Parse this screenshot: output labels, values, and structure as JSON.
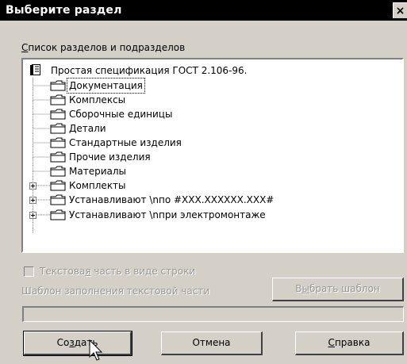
{
  "window": {
    "title": "Выберите раздел",
    "close_glyph": "×"
  },
  "section_list": {
    "label_prefix": "",
    "label_mnemonic": "С",
    "label_rest": "писок разделов и подразделов",
    "root": {
      "label": "Простая спецификация ГОСТ 2.106-96.",
      "icon": "document-book-icon"
    },
    "items": [
      {
        "label": "Документация",
        "icon": "folder-icon",
        "selected": true,
        "expandable": false
      },
      {
        "label": "Комплексы",
        "icon": "folder-icon",
        "expandable": false
      },
      {
        "label": "Сборочные единицы",
        "icon": "folder-icon",
        "expandable": false
      },
      {
        "label": "Детали",
        "icon": "folder-icon",
        "expandable": false
      },
      {
        "label": "Стандартные изделия",
        "icon": "folder-icon",
        "expandable": false
      },
      {
        "label": "Прочие изделия",
        "icon": "folder-icon",
        "expandable": false
      },
      {
        "label": "Материалы",
        "icon": "folder-icon",
        "expandable": false
      },
      {
        "label": "Комплекты",
        "icon": "folder-icon",
        "expandable": true
      },
      {
        "label": "Устанавливают \\nпо #XXX.XXXXXX.XXX#",
        "icon": "folder-icon",
        "expandable": true
      },
      {
        "label": "Устанавливают \\nпри электромонтаже",
        "icon": "folder-icon",
        "expandable": true
      }
    ]
  },
  "text_line_checkbox": {
    "prefix": "Текстова",
    "mnemonic": "я",
    "rest": " часть в виде строки",
    "checked": false,
    "enabled": false
  },
  "template": {
    "label": "Шаблон заполнения текстовой части",
    "value": "",
    "choose_prefix": "В",
    "choose_mnemonic": "ы",
    "choose_rest": "брать шаблон"
  },
  "buttons": {
    "create_prefix": "Со",
    "create_mnemonic": "з",
    "create_rest": "дать",
    "cancel": "Отмена",
    "help_mnemonic": "С",
    "help_prefix": "",
    "help_rest": "правка"
  },
  "colors": {
    "face": "#d4d0c8",
    "titlebar": "#000000",
    "disabled_text": "#9a9891"
  }
}
